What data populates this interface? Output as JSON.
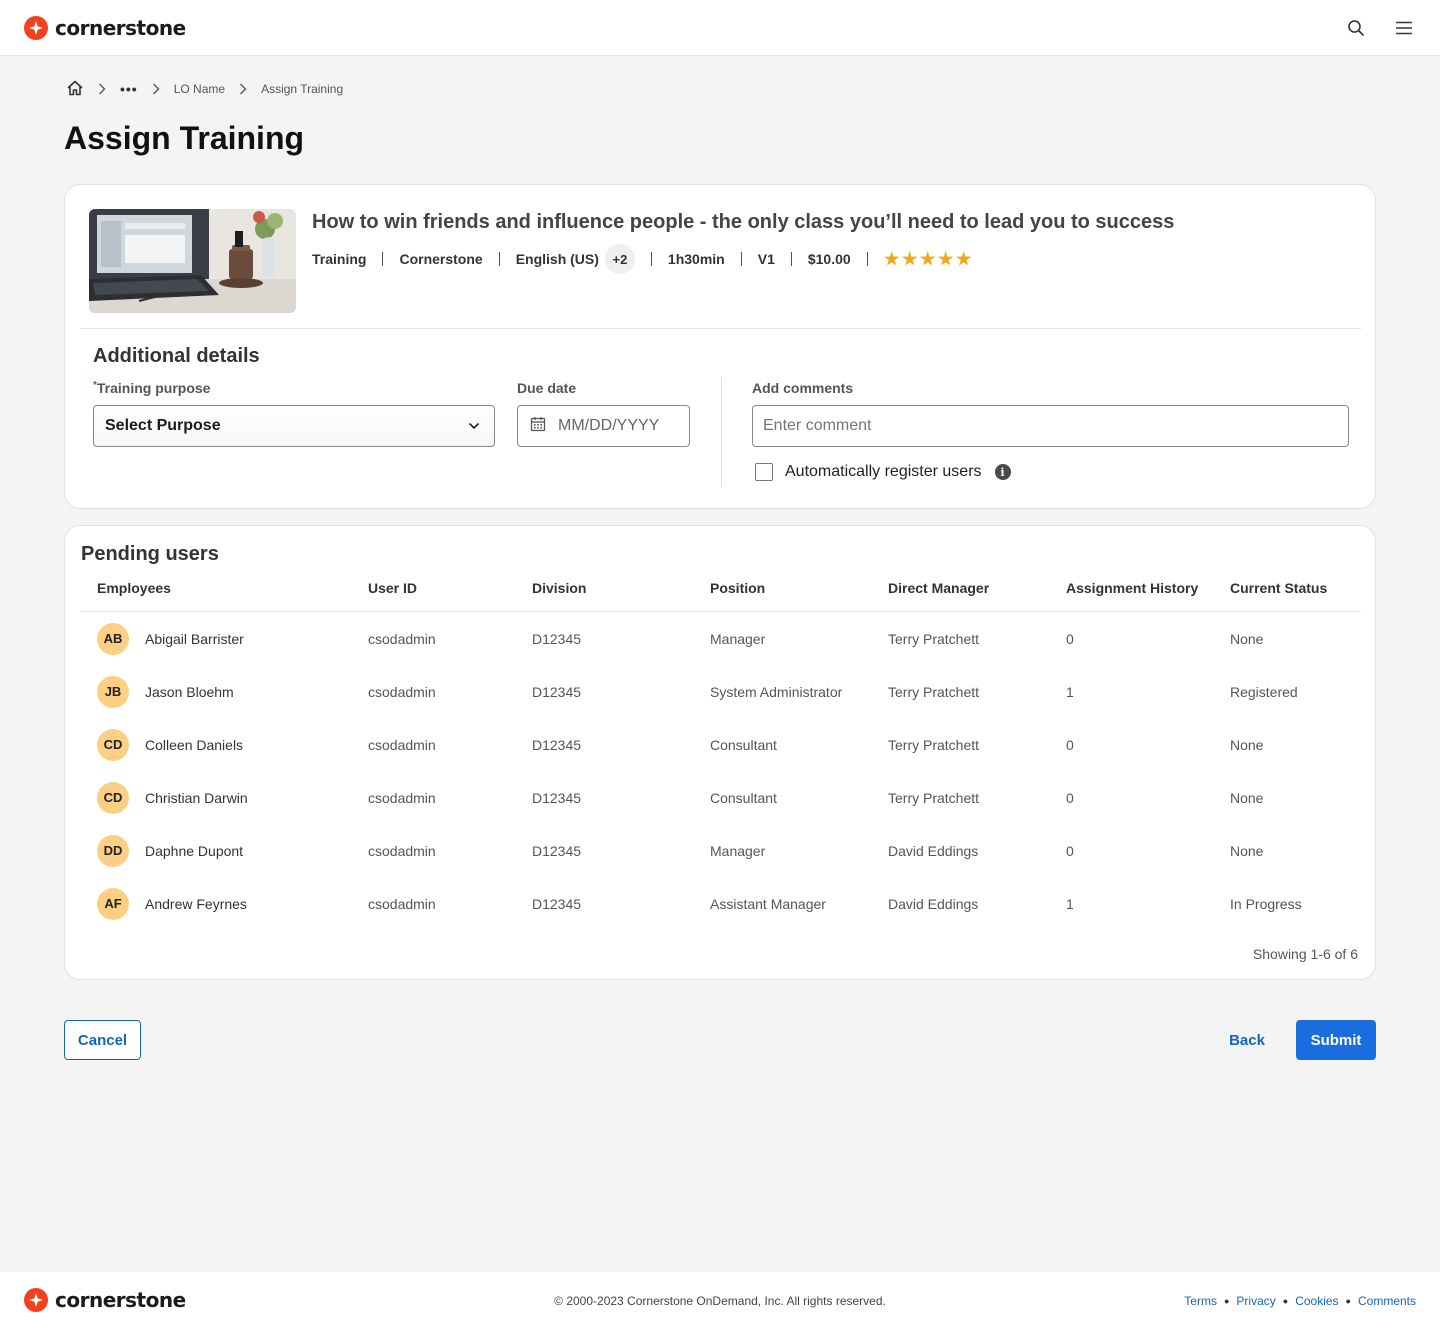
{
  "header": {
    "logo_text": "cornerstone",
    "search_icon": "search-icon",
    "menu_icon": "hamburger-menu-icon"
  },
  "breadcrumb": {
    "home_icon": "home-icon",
    "more": "•••",
    "items": [
      "LO Name",
      "Assign Training"
    ]
  },
  "page_title": "Assign Training",
  "course": {
    "title": "How to win friends and influence people - the only class you’ll need to lead you to success",
    "type": "Training",
    "provider": "Cornerstone",
    "language": "English (US)",
    "extra_languages": "+2",
    "duration": "1h30min",
    "version": "V1",
    "price": "$10.00",
    "rating": 5,
    "rating_color": "#f2a81d"
  },
  "details": {
    "heading": "Additional details",
    "purpose_label": "Training purpose",
    "purpose_required": "*",
    "purpose_value": "Select Purpose",
    "due_label": "Due date",
    "due_placeholder": "MM/DD/YYYY",
    "comments_label": "Add comments",
    "comments_placeholder": "Enter comment",
    "auto_register_label": "Automatically register users",
    "auto_register_checked": false
  },
  "pending": {
    "heading": "Pending users",
    "columns": [
      "Employees",
      "User ID",
      "Division",
      "Position",
      "Direct Manager",
      "Assignment History",
      "Current Status"
    ],
    "rows": [
      {
        "initials": "AB",
        "name": "Abigail Barrister",
        "user_id": "csodadmin",
        "division": "D12345",
        "position": "Manager",
        "manager": "Terry Pratchett",
        "history": "0",
        "status": "None"
      },
      {
        "initials": "JB",
        "name": "Jason Bloehm",
        "user_id": "csodadmin",
        "division": "D12345",
        "position": "System Administrator",
        "manager": "Terry Pratchett",
        "history": "1",
        "status": "Registered"
      },
      {
        "initials": "CD",
        "name": "Colleen Daniels",
        "user_id": "csodadmin",
        "division": "D12345",
        "position": "Consultant",
        "manager": "Terry Pratchett",
        "history": "0",
        "status": "None"
      },
      {
        "initials": "CD",
        "name": "Christian Darwin",
        "user_id": "csodadmin",
        "division": "D12345",
        "position": "Consultant",
        "manager": "Terry Pratchett",
        "history": "0",
        "status": "None"
      },
      {
        "initials": "DD",
        "name": "Daphne Dupont",
        "user_id": "csodadmin",
        "division": "D12345",
        "position": "Manager",
        "manager": "David Eddings",
        "history": "0",
        "status": "None"
      },
      {
        "initials": "AF",
        "name": "Andrew Feyrnes",
        "user_id": "csodadmin",
        "division": "D12345",
        "position": "Assistant Manager",
        "manager": "David Eddings",
        "history": "1",
        "status": "In Progress"
      }
    ],
    "showing": "Showing 1-6 of 6"
  },
  "actions": {
    "cancel": "Cancel",
    "back": "Back",
    "submit": "Submit"
  },
  "footer": {
    "logo_text": "cornerstone",
    "copyright": "© 2000-2023 Cornerstone OnDemand, Inc.  All rights reserved.",
    "links": [
      "Terms",
      "Privacy",
      "Cookies",
      "Comments"
    ]
  },
  "colors": {
    "brand": "#f2421d",
    "primary": "#1a6dde",
    "link": "#1565c0",
    "avatar": "#fccf84"
  }
}
